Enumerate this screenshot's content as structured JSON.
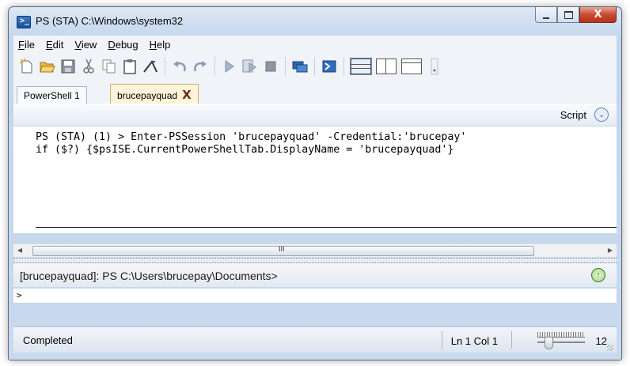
{
  "window": {
    "title": "PS (STA)  C:\\Windows\\system32",
    "minimize_label": "",
    "close_glyph": "X"
  },
  "menu": {
    "items": [
      {
        "mnemonic": "F",
        "rest": "ile"
      },
      {
        "mnemonic": "E",
        "rest": "dit"
      },
      {
        "mnemonic": "V",
        "rest": "iew"
      },
      {
        "mnemonic": "D",
        "rest": "ebug"
      },
      {
        "mnemonic": "H",
        "rest": "elp"
      }
    ]
  },
  "toolbar": {
    "icons": [
      "new-icon",
      "open-icon",
      "save-icon",
      "cut-icon",
      "copy-icon",
      "paste-icon",
      "clear-icon",
      "undo-icon",
      "redo-icon",
      "run-icon",
      "run-selection-icon",
      "stop-icon",
      "new-remote-tab-icon",
      "powershell-icon",
      "layout-top-icon",
      "layout-right-icon",
      "layout-maximized-icon"
    ]
  },
  "tabs": [
    {
      "label": "PowerShell 1",
      "active": false
    },
    {
      "label": "brucepayquad",
      "active": true,
      "close": "X"
    }
  ],
  "script_pane": {
    "label": "Script",
    "toggle": "⌄"
  },
  "editor": {
    "lines": [
      "PS (STA) (1) > Enter-PSSession 'brucepayquad' -Credential:'brucepay'",
      "if ($?) {$psISE.CurrentPowerShellTab.DisplayName = 'brucepayquad'}"
    ]
  },
  "scrollbar": {
    "left_arrow": "◀",
    "right_arrow": "▶",
    "grip": "III"
  },
  "prompt": {
    "text": "[brucepayquad]: PS C:\\Users\\brucepay\\Documents>",
    "icon": "↑"
  },
  "command_input": {
    "value": ">"
  },
  "status": {
    "text": "Completed",
    "position": "Ln 1  Col 1",
    "zoom": "12"
  }
}
